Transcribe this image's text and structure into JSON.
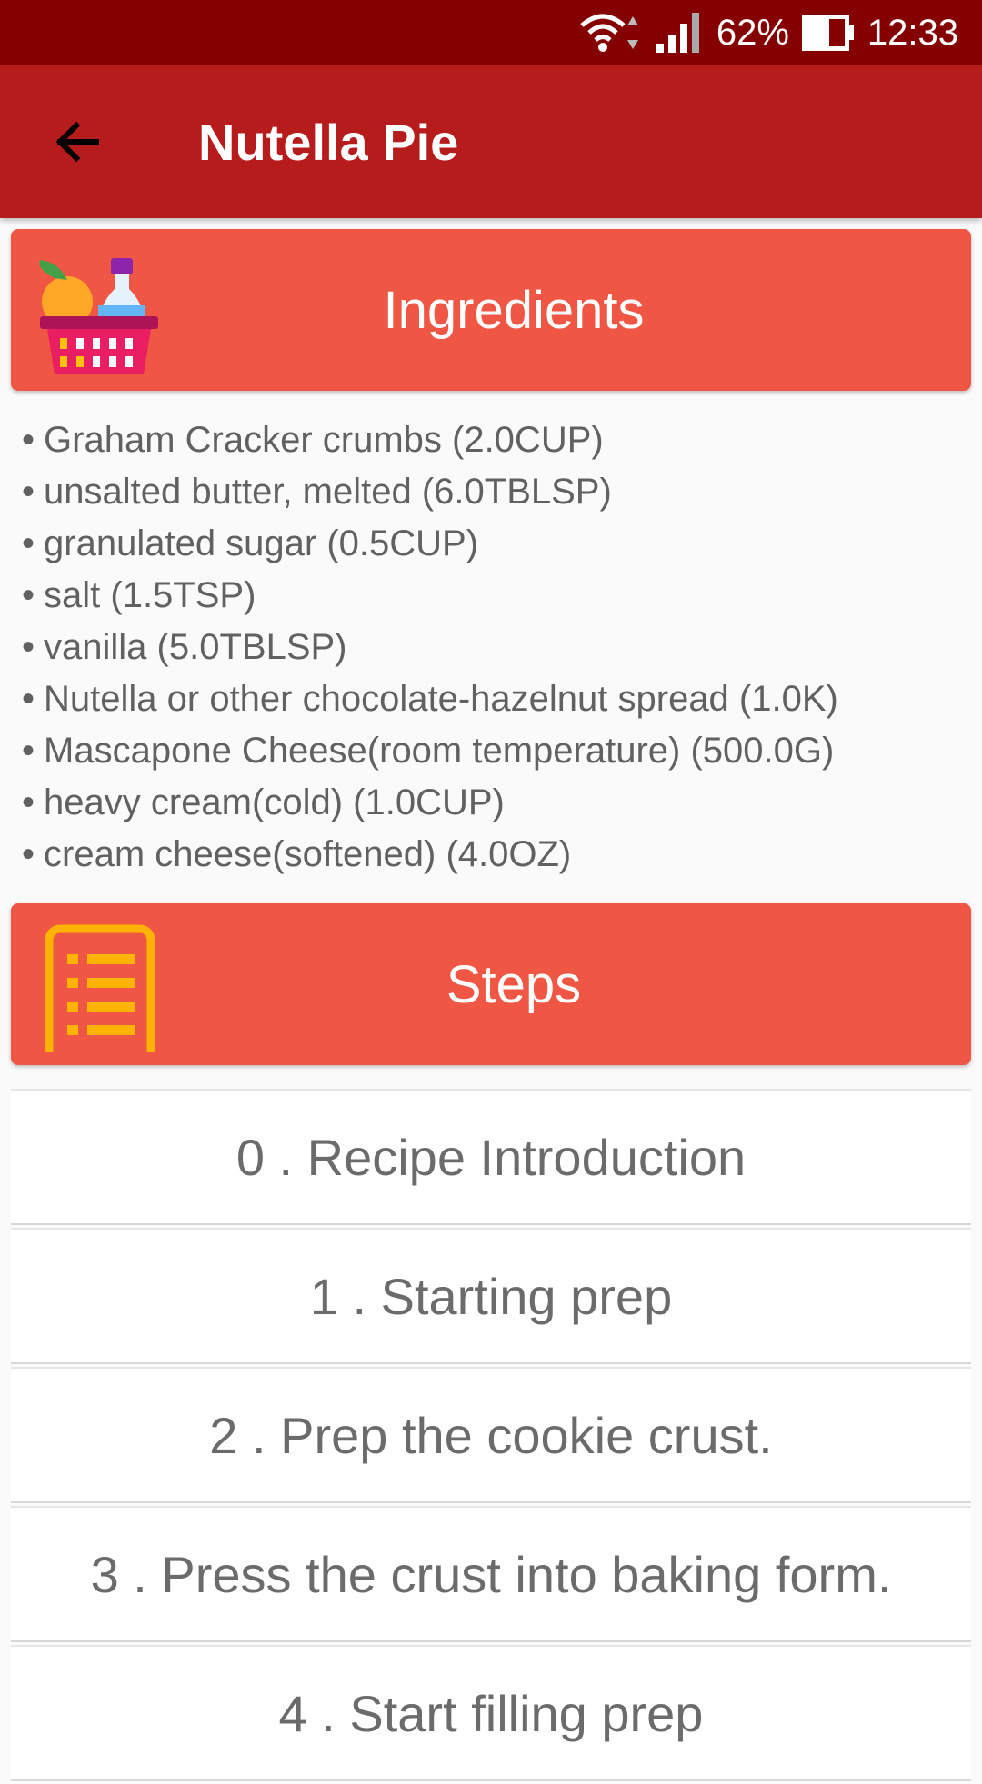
{
  "status_bar": {
    "battery": "62%",
    "time": "12:33",
    "icons": [
      "wifi-icon",
      "signal-icon",
      "battery-icon"
    ]
  },
  "app_bar": {
    "title": "Nutella Pie",
    "back_icon": "arrow-left-icon"
  },
  "ingredients": {
    "header": "Ingredients",
    "icon": "grocery-basket-icon",
    "items": [
      "Graham Cracker crumbs (2.0CUP)",
      "unsalted butter, melted (6.0TBLSP)",
      "granulated sugar (0.5CUP)",
      "salt (1.5TSP)",
      "vanilla (5.0TBLSP)",
      "Nutella or other chocolate-hazelnut spread (1.0K)",
      "Mascapone Cheese(room temperature) (500.0G)",
      "heavy cream(cold) (1.0CUP)",
      "cream cheese(softened) (4.0OZ)"
    ]
  },
  "steps": {
    "header": "Steps",
    "icon": "list-document-icon",
    "items": [
      "0 . Recipe Introduction",
      "1 . Starting prep",
      "2 . Prep the cookie crust.",
      "3 . Press the crust into baking form.",
      "4 . Start filling prep"
    ]
  },
  "colors": {
    "status_bar": "#850000",
    "app_bar": "#b71c1c",
    "section_header": "#ef5744",
    "step_icon": "#ffb300"
  }
}
